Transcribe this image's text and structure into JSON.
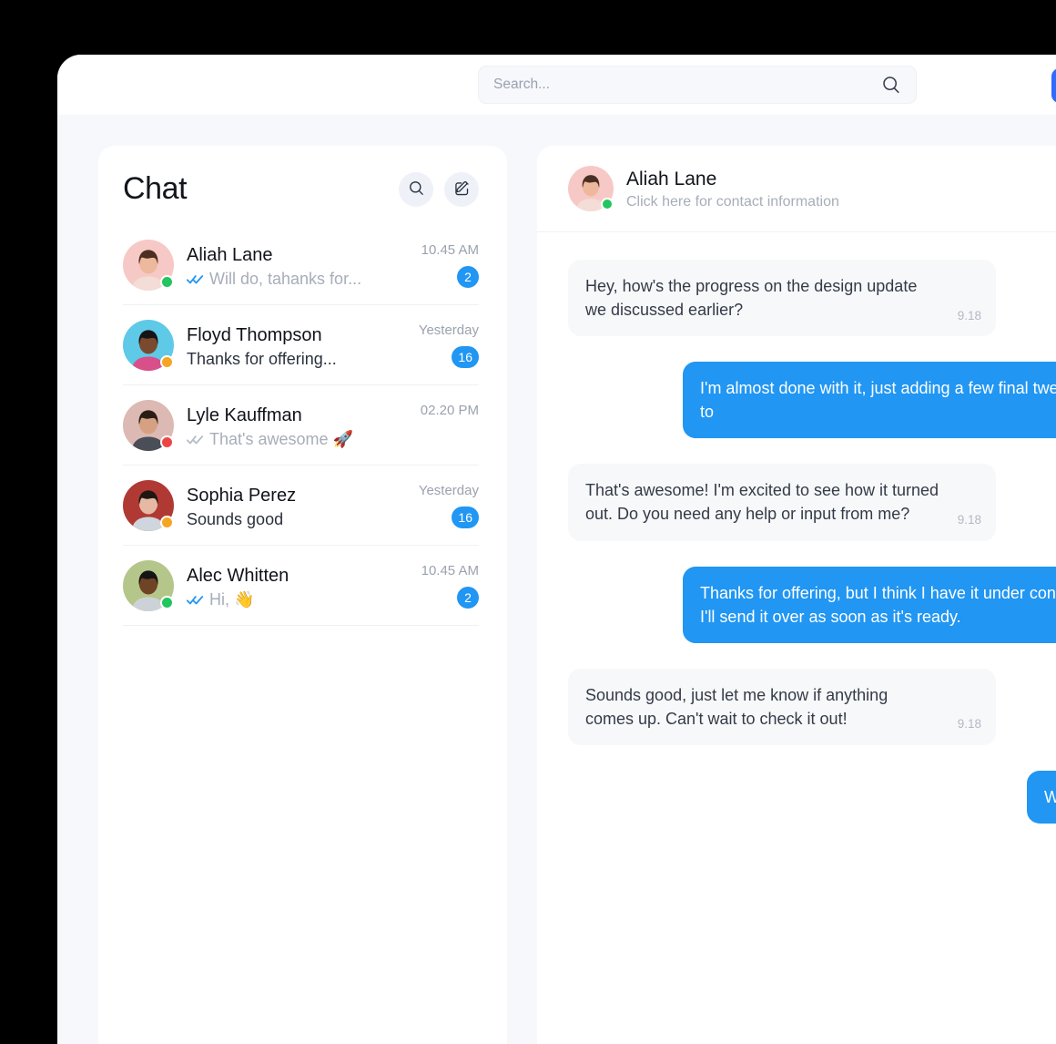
{
  "topbar": {
    "search": {
      "placeholder": "Search...",
      "value": "",
      "icon": "search-icon"
    },
    "action_button": {
      "label": "",
      "color": "#2f6bff"
    }
  },
  "chat_list": {
    "title": "Chat",
    "actions": [
      {
        "name": "search-icon",
        "label": "Search"
      },
      {
        "name": "compose-icon",
        "label": "Compose"
      }
    ],
    "conversations": [
      {
        "name": "Aliah Lane",
        "preview": "Will do, tahanks for...",
        "time": "10.45 AM",
        "unread": "2",
        "has_unread": true,
        "read_receipt": "double-check-blue",
        "status": "online",
        "status_color": "#22c55e",
        "avatar_bg": "#f7c9c6"
      },
      {
        "name": "Floyd Thompson",
        "preview": "Thanks for offering...",
        "time": "Yesterday",
        "unread": "16",
        "has_unread": true,
        "read_receipt": "none",
        "status": "away",
        "status_color": "#f5a524",
        "avatar_bg": "#5fc9e8"
      },
      {
        "name": "Lyle Kauffman",
        "preview": "That's awesome 🚀",
        "time": "02.20 PM",
        "unread": "",
        "has_unread": false,
        "read_receipt": "double-check-gray",
        "status": "busy",
        "status_color": "#ef4444",
        "avatar_bg": "#ddb9b4"
      },
      {
        "name": "Sophia Perez",
        "preview": "Sounds good",
        "time": "Yesterday",
        "unread": "16",
        "has_unread": true,
        "read_receipt": "none",
        "status": "away",
        "status_color": "#f5a524",
        "avatar_bg": "#b03a33"
      },
      {
        "name": "Alec Whitten",
        "preview": "Hi, 👋",
        "time": "10.45 AM",
        "unread": "2",
        "has_unread": true,
        "read_receipt": "double-check-blue",
        "status": "online",
        "status_color": "#22c55e",
        "avatar_bg": "#b5c68a"
      }
    ]
  },
  "conversation": {
    "contact_name": "Aliah Lane",
    "contact_subtitle": "Click here for contact information",
    "status": "online",
    "status_color": "#22c55e",
    "avatar_bg": "#f7c9c6",
    "messages": [
      {
        "direction": "incoming",
        "text": "Hey, how's the progress on the design update we discussed earlier?",
        "time": "9.18"
      },
      {
        "direction": "outgoing",
        "text": "I'm almost done with it, just adding a few final tweaks to",
        "time": ""
      },
      {
        "direction": "incoming",
        "text": "That's awesome! I'm excited to see how it turned out. Do you need any help or input from me?",
        "time": "9.18"
      },
      {
        "direction": "outgoing",
        "text": "Thanks for offering, but I think I have it under control. I'll send it over as soon as it's ready.",
        "time": ""
      },
      {
        "direction": "incoming",
        "text": "Sounds good, just let me know if anything comes up. Can't wait to check it out!",
        "time": "9.18"
      },
      {
        "direction": "outgoing",
        "text": "Will do",
        "time": ""
      }
    ]
  },
  "colors": {
    "accent_blue": "#2196f3",
    "top_action_blue": "#2f6bff",
    "workspace_bg": "#f7f8fc",
    "panel_bg": "#ffffff",
    "incoming_bubble": "#f7f8fa",
    "muted_text": "#a7adb9"
  }
}
